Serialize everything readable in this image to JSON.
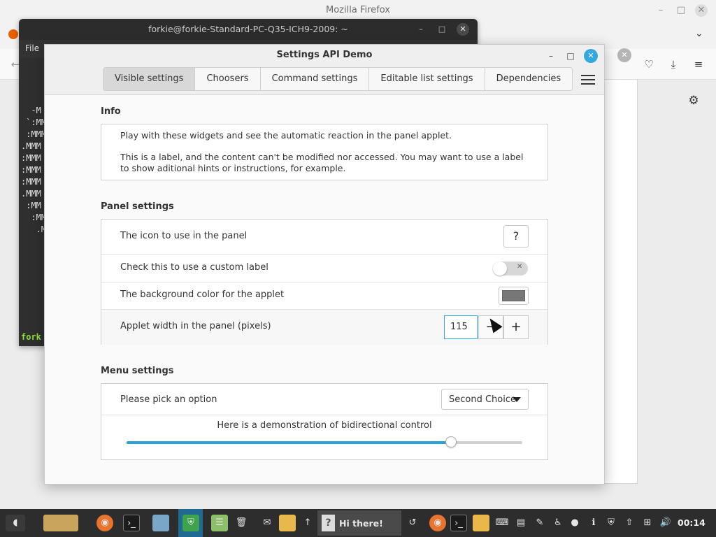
{
  "firefox": {
    "title": "Mozilla Firefox",
    "minimize_icon": "–",
    "maximize_icon": "□",
    "close_icon": "✕"
  },
  "terminal": {
    "title": "forkie@forkie-Standard-PC-Q35-ICH9-2009: ~",
    "menu_file": "File",
    "lines": [
      "  -M",
      " `:MM",
      " :MMM",
      ".MMM",
      ":MMM",
      ":MMM",
      ":MMM",
      ".MMM",
      " :MM",
      "  :MM",
      "   .M"
    ],
    "prompt": "fork"
  },
  "dialog": {
    "title": "Settings API Demo",
    "tabs": [
      "Visible settings",
      "Choosers",
      "Command settings",
      "Editable list settings",
      "Dependencies"
    ],
    "active_tab": 0,
    "info": {
      "heading": "Info",
      "line1": "Play with these widgets and see the automatic reaction in the panel applet.",
      "line2": "This is a label, and the content can't be modified nor accessed. You may want to use a label to show aditional hints or instructions, for example."
    },
    "panel": {
      "heading": "Panel settings",
      "icon_label": "The icon to use in the panel",
      "icon_value": "?",
      "custom_label_label": "Check this to use a custom label",
      "custom_label_on": false,
      "bg_color_label": "The background color for the applet",
      "bg_color_value": "#777777",
      "width_label": "Applet width in the panel (pixels)",
      "width_value": "115",
      "minus": "−",
      "plus": "+"
    },
    "menu": {
      "heading": "Menu settings",
      "pick_label": "Please pick an option",
      "pick_value": "Second Choice",
      "slider_label": "Here is a demonstration of bidirectional control",
      "slider_fraction": 0.82
    }
  },
  "taskbar": {
    "window_label": "Hi there!",
    "window_icon": "?",
    "clock": "00:14"
  },
  "colors": {
    "accent": "#35a7e0",
    "slider_fill": "#2a9fd8",
    "taskbar": "#2d2d2d"
  }
}
